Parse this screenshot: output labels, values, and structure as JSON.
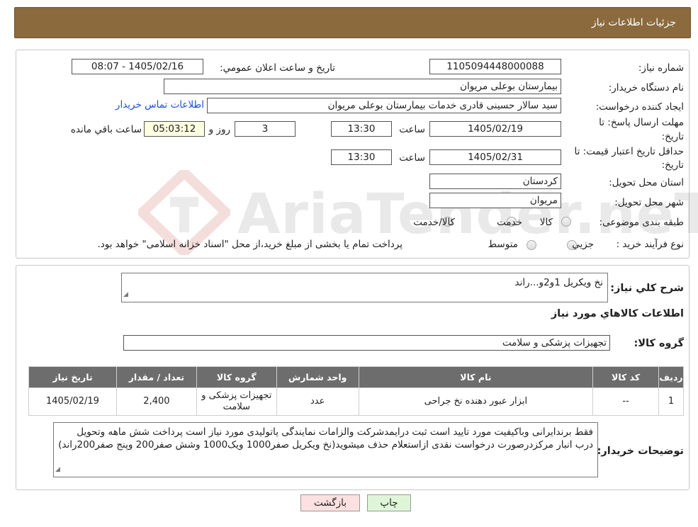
{
  "header": {
    "title": "جزئیات اطلاعات نیاز"
  },
  "info": {
    "need_number_label": "شماره نیاز:",
    "need_number": "1105094448000088",
    "announce_label": "تاریخ و ساعت اعلان عمومي:",
    "announce_value": "1405/02/16 - 08:07",
    "buyer_org_label": "نام دستگاه خریدار:",
    "buyer_org": "بیمارستان بوعلی مریوان",
    "creator_label": "ایجاد کننده درخواست:",
    "creator": "سید سالار حسینی قادری خدمات بیمارستان بوعلی مریوان",
    "contact_link": "اطلاعات تماس خریدار",
    "reply_deadline_label_1": "مهلت ارسال پاسخ: تا",
    "reply_deadline_label_2": "تاریخ:",
    "reply_date": "1405/02/19",
    "time_label": "ساعت",
    "reply_time": "13:30",
    "days_value": "3",
    "days_label": "روز و",
    "remaining_time": "05:03:12",
    "remaining_label": "ساعت باقي مانده",
    "price_validity_label_1": "حداقل تاریخ اعتبار قیمت: تا",
    "price_validity_label_2": "تاریخ:",
    "price_validity_date": "1405/02/31",
    "price_validity_time": "13:30",
    "province_label": "استان محل تحویل:",
    "province": "کردستان",
    "city_label": "شهر محل تحویل:",
    "city": "مریوان",
    "category_label": "طبقه بندی موضوعی:",
    "category_options": [
      "کالا",
      "خدمت",
      "کالا/خدمت"
    ],
    "process_label": "نوع فرآیند خرید :",
    "process_options": [
      "جزیي",
      "متوسط"
    ],
    "process_note": "پرداخت تمام یا بخشی از مبلغ خرید،از محل \"اسناد خزانه اسلامی\" خواهد بود."
  },
  "watermark": {
    "text": "AriaTender.neT"
  },
  "details": {
    "description_label": "شرح کلي نیاز:",
    "description": "نخ ویکریل 1و2و...راند",
    "items_title": "اطلاعات کالاهاي مورد نیاز",
    "group_label": "گروه کالا:",
    "group_value": "تجهیزات پزشکی و سلامت"
  },
  "table": {
    "headers": [
      "ردیف",
      "کد کالا",
      "نام کالا",
      "واحد شمارش",
      "گروه کالا",
      "تعداد / مقدار",
      "تاریخ نیاز"
    ],
    "rows": [
      {
        "row": "1",
        "code": "--",
        "name": "ابزار عبور دهنده نخ جراحی",
        "unit": "عدد",
        "group": "تجهیزات پزشکی و سلامت",
        "qty": "2,400",
        "date": "1405/02/19"
      }
    ]
  },
  "buyer_notes": {
    "label": "توضیحات خریدار:",
    "text": "فقط برندایرانی وباکیفیت مورد تایید است ثبت درایمدشرکت والزامات نمایندگی یاتولیدی مورد نیاز است پرداخت شش ماهه وتحویل درب انبار مرکزدرصورت درخواست نقدی ازاستعلام حذف میشوید(نخ ویکریل صفر1000 ویک1000 وشش صفر200 وپنج صفر200راند)"
  },
  "buttons": {
    "print": "چاپ",
    "back": "بازگشت"
  },
  "colors": {
    "header_bg": "#8b6a3e",
    "table_header_bg": "#6d6d6d",
    "print_btn": "#dff5d8",
    "back_btn": "#fde0e0",
    "remaining_bg": "#fefee0",
    "link": "#1a4fd6"
  }
}
